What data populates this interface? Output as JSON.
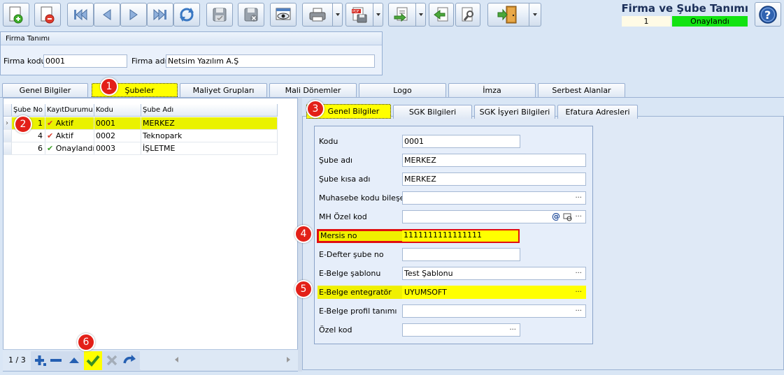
{
  "header": {
    "title": "Firma ve Şube Tanımı",
    "record_no": "1",
    "status": "Onaylandı",
    "status_color": "#12e312"
  },
  "toolbar": {
    "icons": [
      "new-document-icon",
      "delete-document-icon",
      "first-record-icon",
      "previous-record-icon",
      "next-record-icon",
      "last-record-icon",
      "refresh-icon",
      "save-icon",
      "save-cancel-icon",
      "preview-icon",
      "print-icon",
      "pdf-export-icon",
      "export-icon",
      "back-arrow-icon",
      "tools-icon",
      "exit-door-icon",
      "help-icon"
    ]
  },
  "firma": {
    "group_title": "Firma Tanımı",
    "kod_label": "Firma kodu",
    "kod_value": "0001",
    "ad_label": "Firma adı",
    "ad_value": "Netsim Yazılım A.Ş"
  },
  "main_tabs": [
    {
      "label": "Genel Bilgiler"
    },
    {
      "label": "Şubeler"
    },
    {
      "label": "Maliyet Grupları"
    },
    {
      "label": "Mali Dönemler"
    },
    {
      "label": "Logo"
    },
    {
      "label": "İmza"
    },
    {
      "label": "Serbest Alanlar"
    }
  ],
  "grid": {
    "columns": [
      "Şube No",
      "KayıtDurumu",
      "Kodu",
      "Şube Adı"
    ],
    "rows": [
      {
        "no": "1",
        "durum": "Aktif",
        "kod": "0001",
        "ad": "MERKEZ"
      },
      {
        "no": "4",
        "durum": "Aktif",
        "kod": "0002",
        "ad": "Teknopark"
      },
      {
        "no": "6",
        "durum": "Onaylandı",
        "kod": "0003",
        "ad": "İŞLETME"
      }
    ],
    "pager": "1 / 3"
  },
  "sub_tabs": [
    {
      "label": "Genel Bilgiler"
    },
    {
      "label": "SGK Bilgileri"
    },
    {
      "label": "SGK İşyeri Bilgileri"
    },
    {
      "label": "Efatura Adresleri"
    }
  ],
  "form": {
    "kodu": {
      "label": "Kodu",
      "value": "0001"
    },
    "sube_adi": {
      "label": "Şube adı",
      "value": "MERKEZ"
    },
    "sube_kisa_adi": {
      "label": "Şube kısa adı",
      "value": "MERKEZ"
    },
    "muhasebe_kodu": {
      "label": "Muhasebe kodu bileşeni",
      "value": ""
    },
    "mh_ozel_kod": {
      "label": "MH Özel kod",
      "value": ""
    },
    "mersis_no": {
      "label": "Mersis no",
      "value": "1111111111111111"
    },
    "edefter_sube_no": {
      "label": "E-Defter şube no",
      "value": ""
    },
    "ebelge_sablonu": {
      "label": "E-Belge şablonu",
      "value": "Test Şablonu"
    },
    "ebelge_entegrator": {
      "label": "E-Belge entegratör",
      "value": "UYUMSOFT"
    },
    "ebelge_profil": {
      "label": "E-Belge profil tanımı",
      "value": ""
    },
    "ozel_kod": {
      "label": "Özel kod",
      "value": ""
    }
  },
  "badges": [
    "1",
    "2",
    "3",
    "4",
    "5",
    "6"
  ],
  "colors": {
    "highlight": "#ffff00",
    "accent_red": "#e32018",
    "background": "#d9e6f5"
  }
}
